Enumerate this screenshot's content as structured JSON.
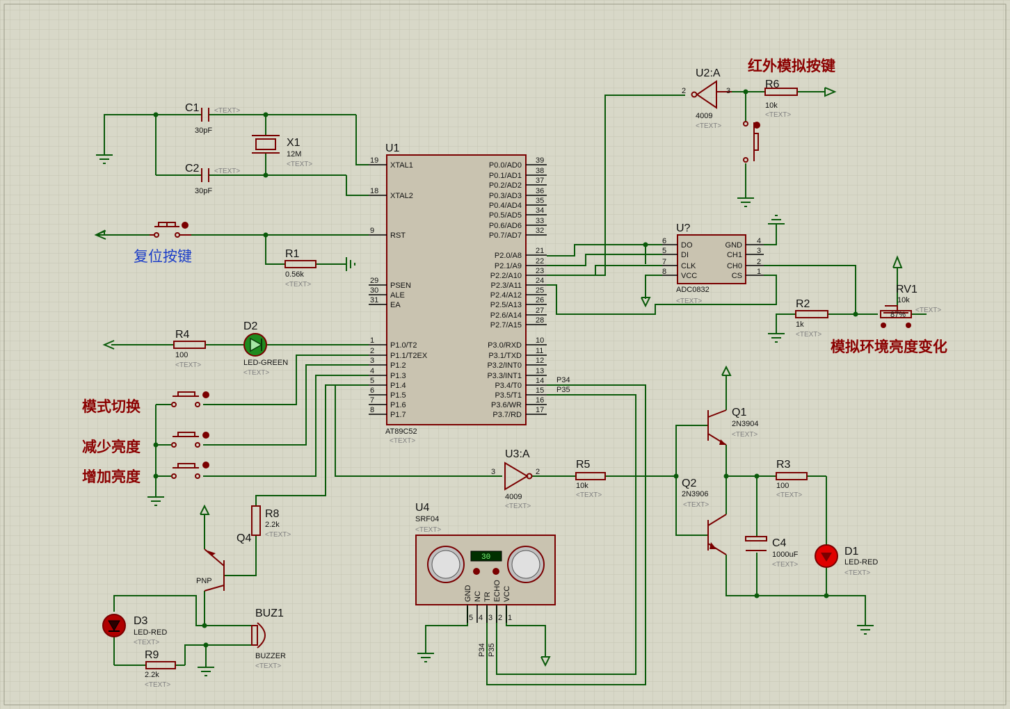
{
  "annotations": {
    "ir_key": "红外模拟按键",
    "reset_key": "复位按键",
    "mode_switch": "模式切换",
    "decrease_brightness": "减少亮度",
    "increase_brightness": "增加亮度",
    "ambient_brightness": "模拟环境亮度变化"
  },
  "text_placeholder": "<TEXT>",
  "u1": {
    "ref": "U1",
    "value": "AT89C52",
    "left_pins": [
      {
        "num": "19",
        "name": "XTAL1"
      },
      {
        "num": "18",
        "name": "XTAL2"
      },
      {
        "num": "9",
        "name": "RST"
      },
      {
        "num": "29",
        "name": "PSEN"
      },
      {
        "num": "30",
        "name": "ALE"
      },
      {
        "num": "31",
        "name": "EA"
      },
      {
        "num": "1",
        "name": "P1.0/T2"
      },
      {
        "num": "2",
        "name": "P1.1/T2EX"
      },
      {
        "num": "3",
        "name": "P1.2"
      },
      {
        "num": "4",
        "name": "P1.3"
      },
      {
        "num": "5",
        "name": "P1.4"
      },
      {
        "num": "6",
        "name": "P1.5"
      },
      {
        "num": "7",
        "name": "P1.6"
      },
      {
        "num": "8",
        "name": "P1.7"
      }
    ],
    "right_pins": [
      {
        "num": "39",
        "name": "P0.0/AD0"
      },
      {
        "num": "38",
        "name": "P0.1/AD1"
      },
      {
        "num": "37",
        "name": "P0.2/AD2"
      },
      {
        "num": "36",
        "name": "P0.3/AD3"
      },
      {
        "num": "35",
        "name": "P0.4/AD4"
      },
      {
        "num": "34",
        "name": "P0.5/AD5"
      },
      {
        "num": "33",
        "name": "P0.6/AD6"
      },
      {
        "num": "32",
        "name": "P0.7/AD7"
      },
      {
        "num": "21",
        "name": "P2.0/A8"
      },
      {
        "num": "22",
        "name": "P2.1/A9"
      },
      {
        "num": "23",
        "name": "P2.2/A10"
      },
      {
        "num": "24",
        "name": "P2.3/A11"
      },
      {
        "num": "25",
        "name": "P2.4/A12"
      },
      {
        "num": "26",
        "name": "P2.5/A13"
      },
      {
        "num": "27",
        "name": "P2.6/A14"
      },
      {
        "num": "28",
        "name": "P2.7/A15"
      },
      {
        "num": "10",
        "name": "P3.0/RXD"
      },
      {
        "num": "11",
        "name": "P3.1/TXD"
      },
      {
        "num": "12",
        "name": "P3.2/INT0"
      },
      {
        "num": "13",
        "name": "P3.3/INT1"
      },
      {
        "num": "14",
        "name": "P3.4/T0"
      },
      {
        "num": "15",
        "name": "P3.5/T1"
      },
      {
        "num": "16",
        "name": "P3.6/WR"
      },
      {
        "num": "17",
        "name": "P3.7/RD"
      }
    ],
    "net_p34": "P34",
    "net_p35": "P35"
  },
  "adc": {
    "ref": "U?",
    "value": "ADC0832",
    "left_pins": [
      {
        "num": "6",
        "name": "DO"
      },
      {
        "num": "5",
        "name": "DI"
      },
      {
        "num": "7",
        "name": "CLK"
      },
      {
        "num": "8",
        "name": "VCC"
      }
    ],
    "right_pins": [
      {
        "num": "4",
        "name": "GND"
      },
      {
        "num": "3",
        "name": "CH1"
      },
      {
        "num": "2",
        "name": "CH0"
      },
      {
        "num": "1",
        "name": "CS"
      }
    ]
  },
  "u2": {
    "ref": "U2:A",
    "value": "4009",
    "pin_in": "2",
    "pin_out": "3"
  },
  "u3": {
    "ref": "U3:A",
    "value": "4009",
    "pin_in": "3",
    "pin_out": "2"
  },
  "u4": {
    "ref": "U4",
    "value": "SRF04",
    "display": "30",
    "pins": [
      {
        "num": "5",
        "name": "GND"
      },
      {
        "num": "4",
        "name": "NC"
      },
      {
        "num": "3",
        "name": "TR"
      },
      {
        "num": "2",
        "name": "ECHO"
      },
      {
        "num": "1",
        "name": "VCC"
      }
    ],
    "net_p34": "P34",
    "net_p35": "P35"
  },
  "c1": {
    "ref": "C1",
    "value": "30pF"
  },
  "c2": {
    "ref": "C2",
    "value": "30pF"
  },
  "x1": {
    "ref": "X1",
    "value": "12M"
  },
  "r1": {
    "ref": "R1",
    "value": "0.56k"
  },
  "r2": {
    "ref": "R2",
    "value": "1k"
  },
  "r3": {
    "ref": "R3",
    "value": "100"
  },
  "r4": {
    "ref": "R4",
    "value": "100"
  },
  "r5": {
    "ref": "R5",
    "value": "10k"
  },
  "r6": {
    "ref": "R6",
    "value": "10k"
  },
  "r8": {
    "ref": "R8",
    "value": "2.2k"
  },
  "r9": {
    "ref": "R9",
    "value": "2.2k"
  },
  "rv1": {
    "ref": "RV1",
    "value": "10k",
    "setting": "87%"
  },
  "d1": {
    "ref": "D1",
    "value": "LED-RED"
  },
  "d2": {
    "ref": "D2",
    "value": "LED-GREEN"
  },
  "d3": {
    "ref": "D3",
    "value": "LED-RED"
  },
  "q1": {
    "ref": "Q1",
    "value": "2N3904"
  },
  "q2": {
    "ref": "Q2",
    "value": "2N3906"
  },
  "q4": {
    "ref": "Q4",
    "value": "PNP"
  },
  "c4": {
    "ref": "C4",
    "value": "1000uF"
  },
  "buz1": {
    "ref": "BUZ1",
    "value": "BUZZER"
  },
  "colors": {
    "background": "#d8d8c8",
    "wire": "#0a5a0a",
    "component": "#7a0000",
    "annotation_red": "#8b0000",
    "annotation_blue": "#1a3cc8"
  }
}
